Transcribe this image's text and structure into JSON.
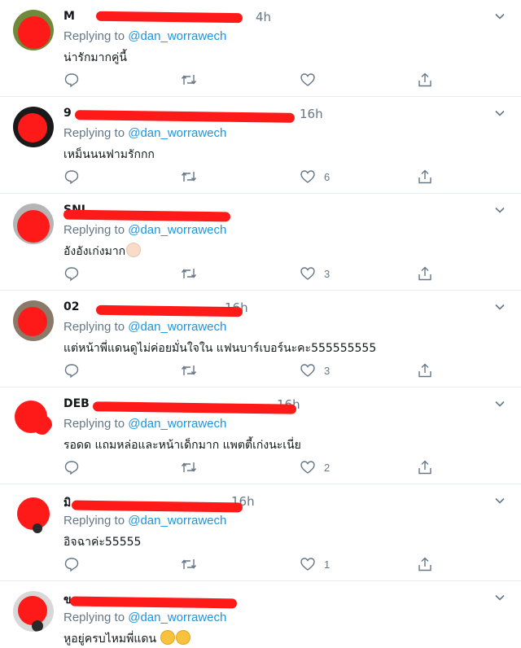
{
  "replying_prefix": "Replying to",
  "tweets": [
    {
      "name": "M",
      "time": "4h",
      "handle": "@dan_worrawech",
      "text": "น่ารักมากคู่นี้",
      "likes": ""
    },
    {
      "name": "9",
      "time": "16h",
      "handle": "@dan_worrawech",
      "text": "เหม็นนนฟามรักกก",
      "likes": "6"
    },
    {
      "name": "SNI",
      "time": "",
      "handle": "@dan_worrawech",
      "text": "อังอังเก่งมาก",
      "likes": "3"
    },
    {
      "name": "02",
      "time": "16h",
      "handle": "@dan_worrawech",
      "text": "แต่หน้าพี่แดนดูไม่ค่อยมั่นใจใน แฟนบาร์เบอร์นะคะ555555555",
      "likes": "3"
    },
    {
      "name": "DEB",
      "time": "16h",
      "handle": "@dan_worrawech",
      "text": "รอดด แถมหล่อและหน้าเด็กมาก แพตตี้เก่งนะเนี่ย",
      "likes": "2"
    },
    {
      "name": "มิ",
      "time": "16h",
      "handle": "@dan_worrawech",
      "text": "อิจฉาค่ะ55555",
      "likes": "1"
    },
    {
      "name": "ข",
      "time": "",
      "handle": "@dan_worrawech",
      "text": "หูอยู่ครบไหมพี่แดน",
      "likes": ""
    }
  ],
  "icons": [
    "reply-icon",
    "retweet-icon",
    "like-icon",
    "share-icon",
    "chevron-down-icon"
  ],
  "colors": {
    "link": "#1b95e0",
    "muted": "#657786",
    "redaction": "#ff1a1a",
    "divider": "#e6ecf0"
  }
}
